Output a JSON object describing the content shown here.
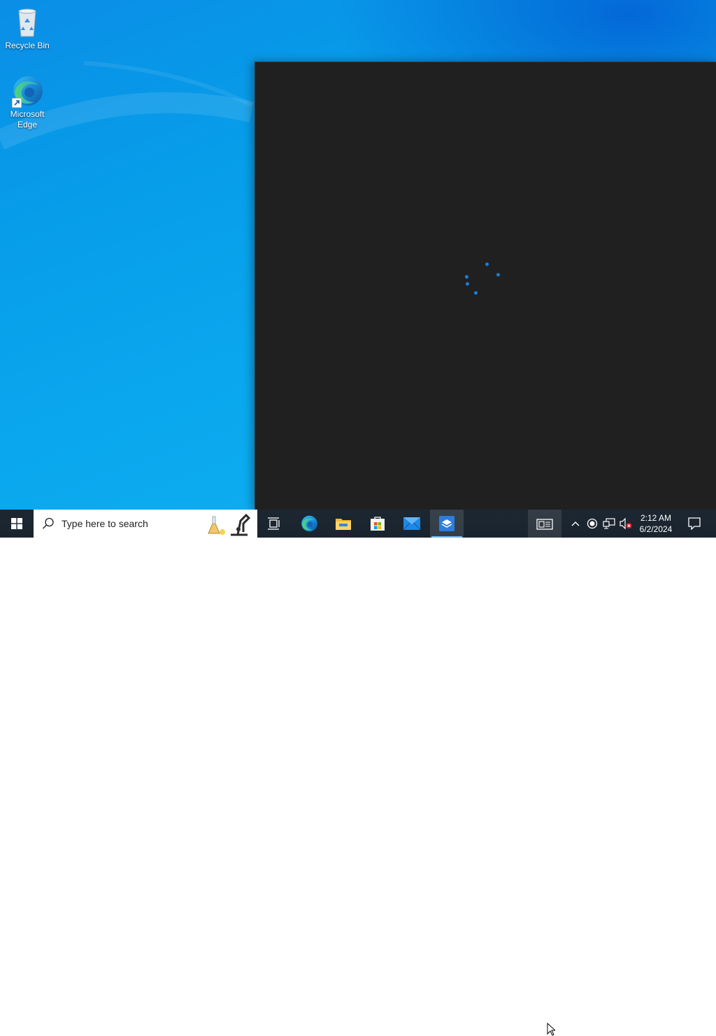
{
  "desktop": {
    "icons": [
      {
        "label": "Recycle Bin",
        "icon": "recycle-bin-icon"
      },
      {
        "label": "Microsoft\nEdge",
        "label_line1": "Microsoft",
        "label_line2": "Edge",
        "icon": "edge-icon"
      }
    ]
  },
  "app_window": {
    "state": "loading",
    "spinner_color": "#1a7fd6",
    "background": "#202020"
  },
  "taskbar": {
    "start_icon": "windows-logo-icon",
    "search": {
      "placeholder": "Type here to search",
      "icon": "search-icon"
    },
    "apps": [
      {
        "name": "Task View",
        "icon": "task-view-icon",
        "active": false
      },
      {
        "name": "Microsoft Edge",
        "icon": "edge-icon",
        "active": false
      },
      {
        "name": "File Explorer",
        "icon": "folder-icon",
        "active": false
      },
      {
        "name": "Microsoft Store",
        "icon": "store-icon",
        "active": false
      },
      {
        "name": "Mail",
        "icon": "mail-icon",
        "active": false
      },
      {
        "name": "Sandbox App",
        "icon": "sandbox-app-icon",
        "active": true
      }
    ],
    "tray": {
      "icons": [
        "news-widget-icon",
        "chevron-up-icon",
        "record-icon",
        "network-icon",
        "volume-muted-icon"
      ],
      "clock": {
        "time": "2:12 AM",
        "date": "6/2/2024"
      },
      "notifications_icon": "notification-icon"
    }
  },
  "colors": {
    "desktop_accent": "#0aa7ee",
    "taskbar": "#1c2731",
    "active_indicator": "#76b9ed"
  }
}
